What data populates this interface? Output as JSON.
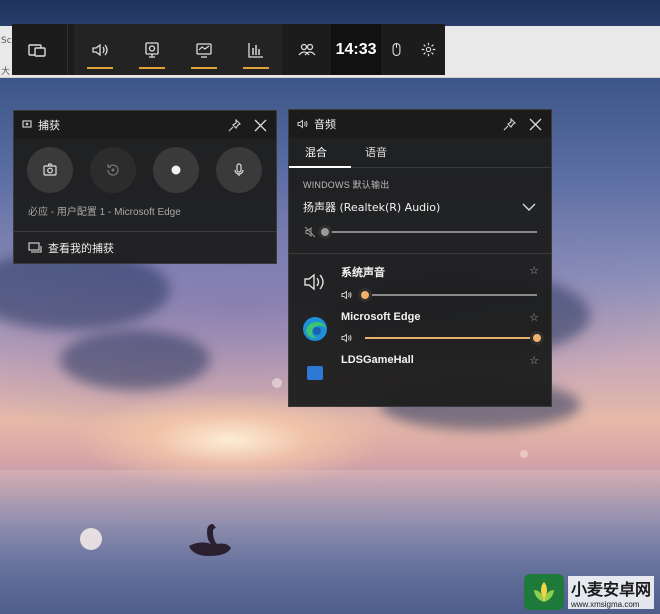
{
  "gamebar": {
    "time": "14:33",
    "buttons": [
      "widget-menu",
      "audio",
      "capture",
      "performance",
      "resources",
      "social"
    ],
    "accent": "#e0a23a"
  },
  "browser_fragments": [
    "Sc",
    "大"
  ],
  "capture": {
    "title": "捕获",
    "info": "必应 - 用户配置 1 - Microsoft Edge",
    "link": "查看我的捕获"
  },
  "audio": {
    "title": "音频",
    "tabs": [
      "混合",
      "语音"
    ],
    "output_label": "WINDOWS 默认输出",
    "device": "扬声器 (Realtek(R) Audio)",
    "master_level": 0.0,
    "apps": [
      {
        "name": "系统声音",
        "level": 0.0
      },
      {
        "name": "Microsoft Edge",
        "level": 1.0
      },
      {
        "name": "LDSGameHall",
        "level": null
      }
    ],
    "accent": "#f0b26a"
  },
  "watermark": {
    "title": "小麦安卓网",
    "url": "www.xmsigma.com"
  }
}
